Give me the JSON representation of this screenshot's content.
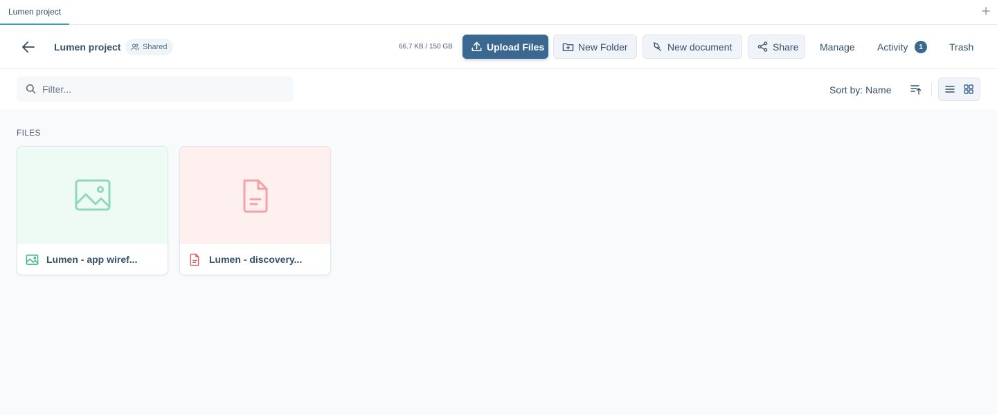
{
  "tab": {
    "label": "Lumen project"
  },
  "header": {
    "title": "Lumen project",
    "badge": "Shared",
    "storage": "66.7 KB / 150 GB",
    "upload_label": "Upload Files",
    "new_folder_label": "New Folder",
    "new_document_label": "New document",
    "share_label": "Share",
    "manage_label": "Manage",
    "activity_label": "Activity",
    "activity_count": "1",
    "trash_label": "Trash"
  },
  "toolbar": {
    "filter_placeholder": "Filter...",
    "sort_label": "Sort by: Name"
  },
  "files": {
    "section_label": "FILES",
    "items": [
      {
        "name": "Lumen - app wiref...",
        "icon": "image-icon",
        "color": "#2fb784"
      },
      {
        "name": "Lumen - discovery...",
        "icon": "document-icon",
        "color": "#e8585c"
      }
    ]
  },
  "colors": {
    "primary": "#3a6891",
    "tab_accent": "#3aa3b4",
    "image_accent": "#2fb784",
    "document_accent": "#e8585c"
  }
}
